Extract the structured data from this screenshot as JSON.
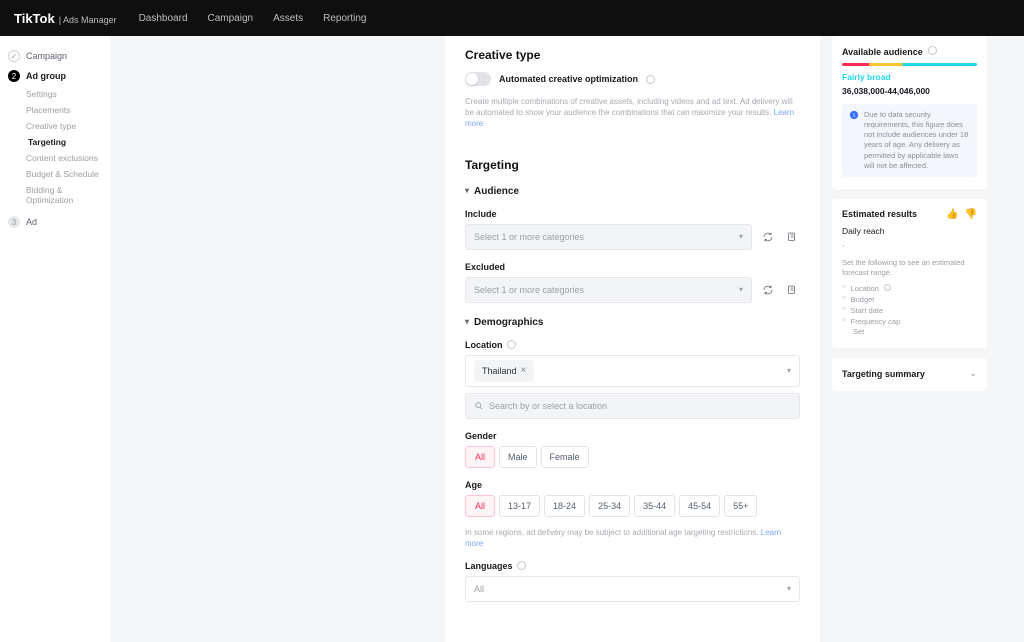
{
  "brand": {
    "name": "TikTok",
    "subtitle": "Ads Manager"
  },
  "nav": {
    "items": [
      "Dashboard",
      "Campaign",
      "Assets",
      "Reporting"
    ]
  },
  "sidebar": {
    "steps": [
      {
        "label": "Campaign",
        "state": "done"
      },
      {
        "label": "Ad group",
        "state": "active"
      },
      {
        "label": "Ad",
        "state": "pending"
      }
    ],
    "subitems": [
      "Settings",
      "Placements",
      "Creative type",
      "Targeting",
      "Content exclusions",
      "Budget & Schedule",
      "Bidding & Optimization"
    ],
    "active_sub": "Targeting"
  },
  "creative": {
    "title": "Creative type",
    "aco_label": "Automated creative optimization",
    "aco_desc": "Create multiple combinations of creative assets, including videos and ad text. Ad delivery will be automated to show your audience the combinations that can maximize your results.",
    "learn_more": "Learn more"
  },
  "targeting": {
    "title": "Targeting",
    "audience_header": "Audience",
    "include_label": "Include",
    "include_placeholder": "Select 1 or more categories",
    "excluded_label": "Excluded",
    "excluded_placeholder": "Select 1 or more categories",
    "demographics_header": "Demographics",
    "location_label": "Location",
    "location_chips": [
      "Thailand"
    ],
    "location_search_placeholder": "Search by or select a location",
    "gender_label": "Gender",
    "gender_options": [
      "All",
      "Male",
      "Female"
    ],
    "gender_selected": "All",
    "age_label": "Age",
    "age_options": [
      "All",
      "13-17",
      "18-24",
      "25-34",
      "35-44",
      "45-54",
      "55+"
    ],
    "age_selected": "All",
    "age_note": "In some regions, ad delivery may be subject to additional age targeting restrictions.",
    "age_learn_more": "Learn more",
    "languages_label": "Languages",
    "languages_value": "All"
  },
  "right": {
    "audience_card": {
      "title": "Available audience",
      "band_label": "Fairly broad",
      "range": "36,038,000-44,046,000",
      "note_text": "Due to data security requirements, this figure does not include audiences under 18 years of age. Any delivery as permitted by applicable laws will not be affected."
    },
    "estimated_card": {
      "title": "Estimated results",
      "metric_label": "Daily reach",
      "metric_value": "-",
      "help": "Set the following to see an estimated forecast range.",
      "items": [
        "Location",
        "Budget",
        "Start date",
        "Frequency cap"
      ],
      "set_label": "Set"
    },
    "summary_card": {
      "title": "Targeting summary"
    }
  }
}
